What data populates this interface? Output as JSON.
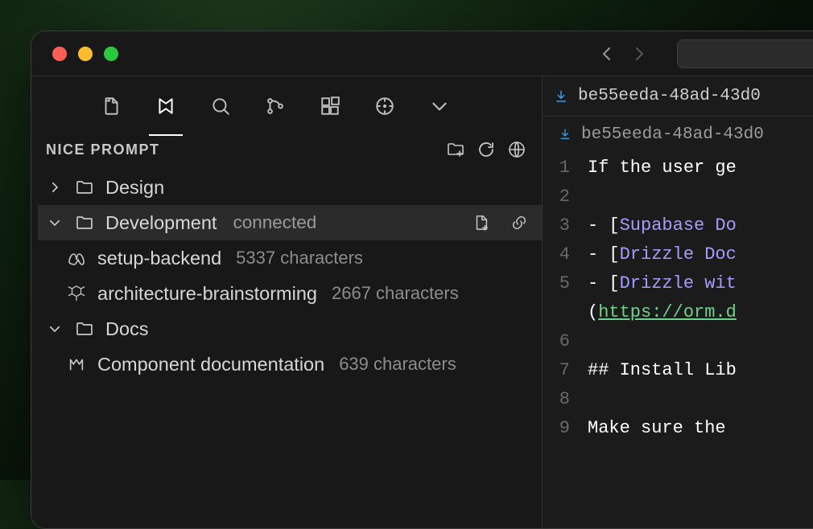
{
  "colors": {
    "traffic_close": "#ff5f57",
    "traffic_min": "#febc2e",
    "traffic_zoom": "#28c840",
    "breadcrumb_icon": "#379cf0"
  },
  "panel_title": "NICE PROMPT",
  "tree": {
    "design": {
      "label": "Design"
    },
    "development": {
      "label": "Development",
      "status": "connected",
      "items": [
        {
          "name": "setup-backend",
          "meta": "5337 characters"
        },
        {
          "name": "architecture-brainstorming",
          "meta": "2667 characters"
        }
      ]
    },
    "docs": {
      "label": "Docs",
      "items": [
        {
          "name": "Component documentation",
          "meta": "639 characters"
        }
      ]
    }
  },
  "editor": {
    "tab_title": "be55eeda-48ad-43d0",
    "breadcrumb": "be55eeda-48ad-43d0",
    "lines": {
      "l1": "If the user ge",
      "l2": "",
      "l3a": "- [",
      "l3b": "Supabase Do",
      "l4a": "- [",
      "l4b": "Drizzle Doc",
      "l5a": "- [",
      "l5b": "Drizzle wit",
      "l5c": "(",
      "l5d": "https://orm.d",
      "l6": "",
      "l7": "## Install Lib",
      "l8": "",
      "l9": "Make sure the "
    }
  }
}
